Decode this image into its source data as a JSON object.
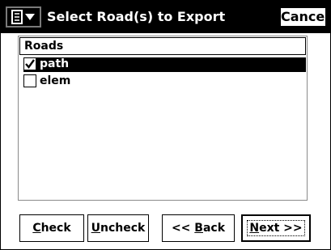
{
  "titlebar": {
    "title": "Select Road(s) to Export",
    "menu_icon": "list-menu-icon",
    "cancel_label": "Cancel"
  },
  "list": {
    "header": "Roads",
    "items": [
      {
        "label": "path",
        "checked": true,
        "selected": true
      },
      {
        "label": "elem",
        "checked": false,
        "selected": false
      }
    ]
  },
  "buttons": {
    "check": {
      "hotkey": "C",
      "rest": "heck"
    },
    "uncheck": {
      "hotkey": "U",
      "rest": "ncheck"
    },
    "back": {
      "pre": "<< ",
      "hotkey": "B",
      "rest": "ack"
    },
    "next": {
      "hotkey": "N",
      "rest": "ext >>"
    }
  },
  "colors": {
    "titlebar_bg": "#000000",
    "selection_bg": "#000000",
    "panel_border": "#8a8a8a"
  }
}
